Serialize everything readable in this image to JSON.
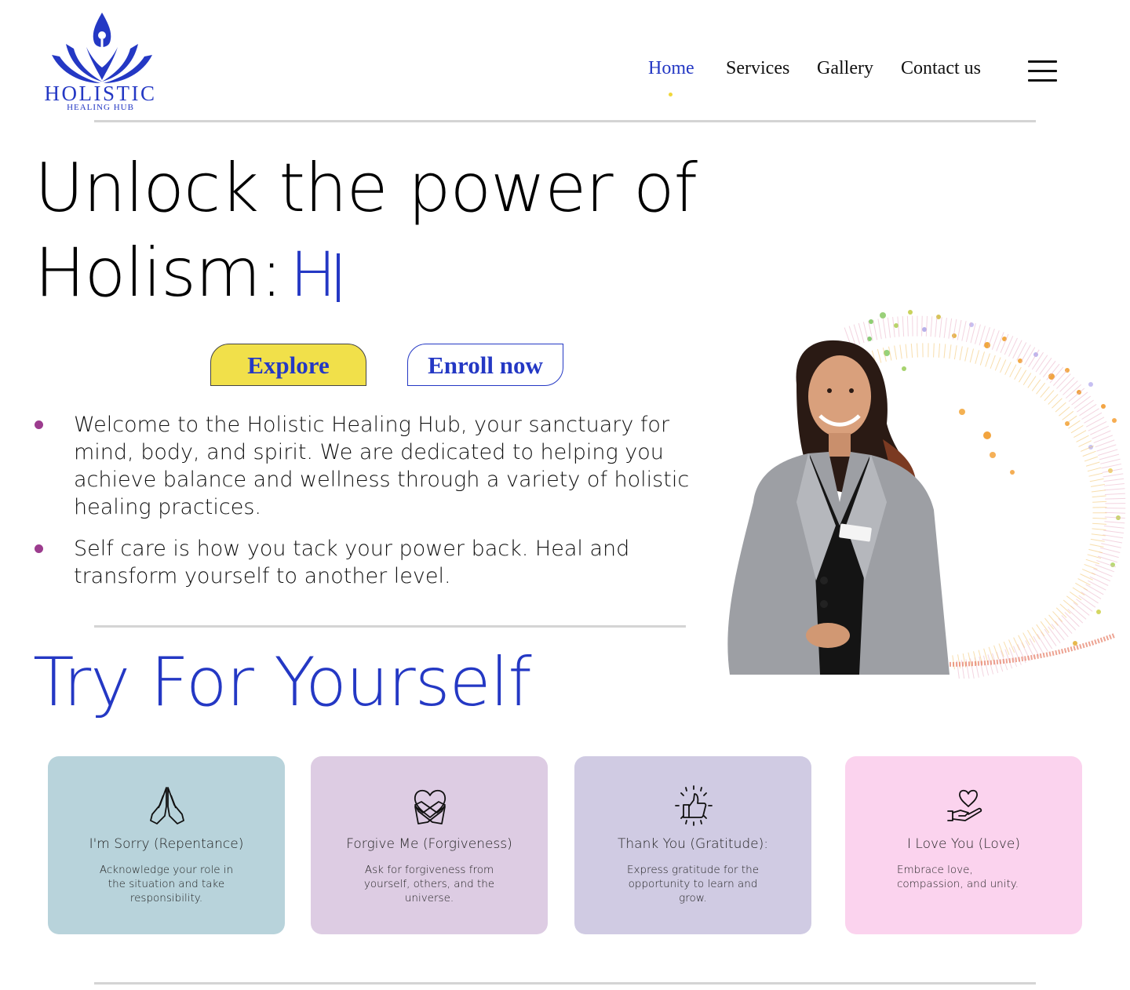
{
  "header": {
    "logo": {
      "title": "HOLISTIC",
      "subtitle": "HEALING HUB"
    },
    "nav": [
      {
        "label": "Home",
        "active": true
      },
      {
        "label": "Services",
        "active": false
      },
      {
        "label": "Gallery",
        "active": false
      },
      {
        "label": "Contact us",
        "active": false
      }
    ],
    "menu_icon": "hamburger-menu-icon"
  },
  "hero": {
    "title_line1": "Unlock the power of",
    "title_line2": "Holism:",
    "typed_text": "H",
    "buttons": {
      "explore": "Explore",
      "enroll": "Enroll now"
    },
    "bullets": [
      "Welcome to the Holistic Healing Hub, your sanctuary for mind, body, and spirit. We are dedicated to helping you achieve balance and wellness through a variety of holistic healing practices.",
      "Self care is how you tack your power back. Heal and transform yourself to another level."
    ]
  },
  "section": {
    "title": "Try For Yourself"
  },
  "cards": [
    {
      "title": "I'm Sorry (Repentance)",
      "desc": "Acknowledge your role in the situation and take responsibility.",
      "icon": "praying-hands-icon",
      "color": "#b8d3db"
    },
    {
      "title": "Forgive Me (Forgiveness)",
      "desc": "Ask for forgiveness from yourself, others, and the universe.",
      "icon": "self-hug-heart-icon",
      "color": "#ddcce3"
    },
    {
      "title": "Thank You (Gratitude):",
      "desc": "Express gratitude for the opportunity to learn and grow.",
      "icon": "thumbs-up-icon",
      "color": "#d0cbe3"
    },
    {
      "title": "I Love You (Love)",
      "desc": "Embrace love, compassion, and unity.",
      "icon": "heart-in-hand-icon",
      "color": "#fbd3ee"
    }
  ],
  "colors": {
    "brand_blue": "#2438c4",
    "explore_yellow": "#f1e04a",
    "bullet_purple": "#9c3c8e"
  }
}
